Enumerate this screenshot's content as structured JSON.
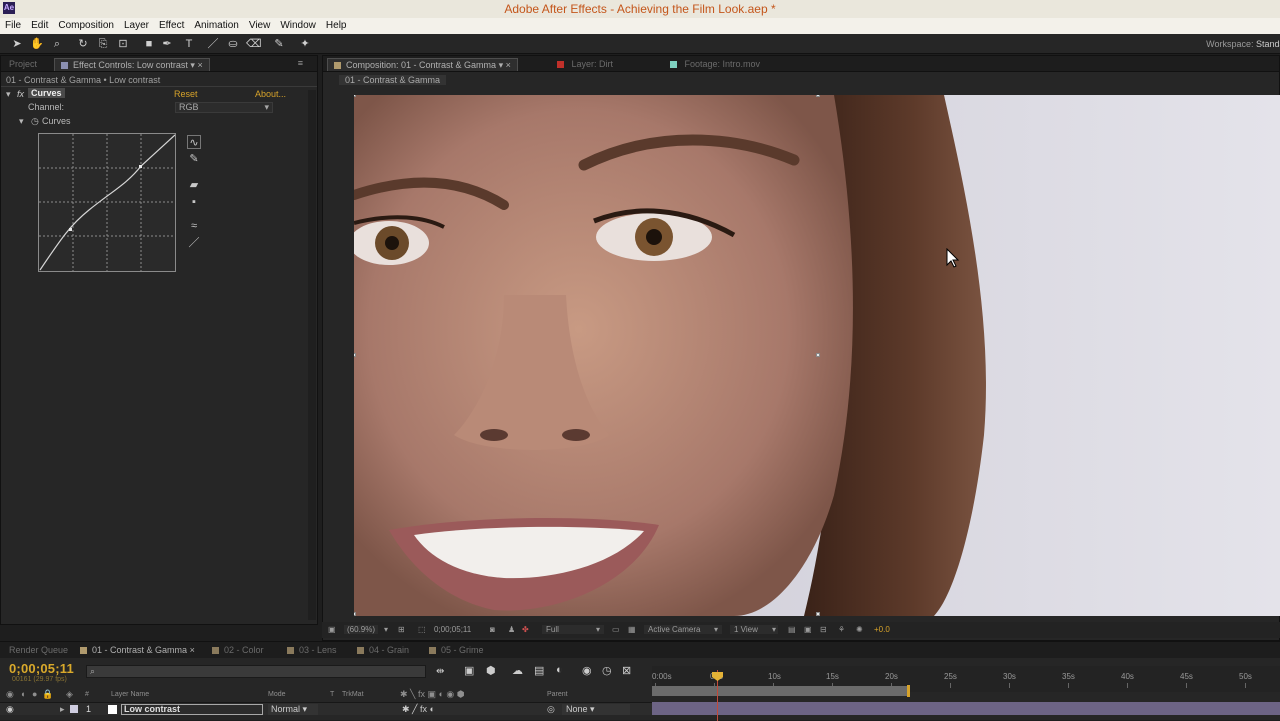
{
  "window": {
    "title": "Adobe After Effects - Achieving the Film Look.aep *",
    "app_badge": "Ae"
  },
  "menu": [
    "File",
    "Edit",
    "Composition",
    "Layer",
    "Effect",
    "Animation",
    "View",
    "Window",
    "Help"
  ],
  "toolbar": {
    "workspace_label": "Workspace:",
    "workspace_value": "Standard"
  },
  "left_panel": {
    "tabs": {
      "project": "Project",
      "effect_controls": "Effect Controls: Low contrast"
    },
    "breadcrumb": "01 - Contrast & Gamma • Low contrast",
    "effect": {
      "fx_label": "fx",
      "name": "Curves",
      "reset": "Reset",
      "about": "About...",
      "channel_label": "Channel:",
      "channel_value": "RGB",
      "curves_label": "Curves"
    }
  },
  "viewer_panel": {
    "tabs": {
      "composition": "Composition: 01 - Contrast & Gamma",
      "layer": "Layer: Dirt",
      "footage": "Footage: Intro.mov"
    },
    "comp_breadcrumb": "01 - Contrast & Gamma",
    "footer": {
      "zoom": "(60.9%)",
      "timecode": "0;00;05;11",
      "resolution": "Full",
      "camera": "Active Camera",
      "views": "1 View",
      "exposure": "+0.0"
    }
  },
  "timeline": {
    "tabs": [
      "Render Queue",
      "01 - Contrast & Gamma",
      "02 - Color",
      "03 - Lens",
      "04 - Grain",
      "05 - Grime"
    ],
    "timecode": "0;00;05;11",
    "frames": "00161 (29.97 fps)",
    "search_placeholder": "",
    "ruler_labels": [
      "0:00s",
      "05s",
      "10s",
      "15s",
      "20s",
      "25s",
      "30s",
      "35s",
      "40s",
      "45s",
      "50s"
    ],
    "columns": {
      "index": "#",
      "layer_name": "Layer Name",
      "mode": "Mode",
      "t": "T",
      "trkmat": "TrkMat",
      "parent": "Parent"
    },
    "layers": [
      {
        "index": "1",
        "name": "Low contrast",
        "mode": "Normal",
        "parent": "None"
      }
    ]
  },
  "colors": {
    "accent_orange": "#d6a22a",
    "title_orange": "#c4561b",
    "layer_bar": "#6d6485",
    "playhead": "#c24a3a"
  }
}
